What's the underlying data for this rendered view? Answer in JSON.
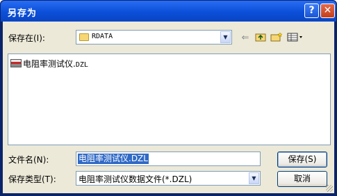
{
  "dialog": {
    "title": "另存为",
    "help_glyph": "?",
    "close_glyph": "✕"
  },
  "location": {
    "label": "保存在(I):",
    "folder": "RDATA"
  },
  "toolbar": {
    "back_icon": "back-arrow-icon",
    "up_icon": "up-folder-icon",
    "new_folder_icon": "new-folder-icon",
    "view_icon": "view-menu-icon"
  },
  "files": [
    {
      "name": "电阻率测试仪.",
      "ext": "DZL"
    }
  ],
  "filename": {
    "label": "文件名(N):",
    "value": "电阻率测试仪.DZL"
  },
  "filetype": {
    "label": "保存类型(T):",
    "value": "电阻率测试仪数据文件(*.DZL)"
  },
  "buttons": {
    "save": "保存(S)",
    "cancel": "取消"
  },
  "colors": {
    "titlebar": "#0b4fd8",
    "face": "#ece9d8",
    "selection": "#316ac5"
  }
}
